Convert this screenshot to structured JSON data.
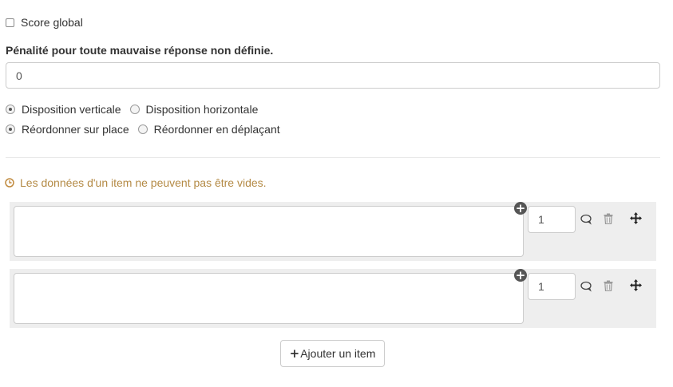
{
  "score_global": {
    "label": "Score global",
    "checked": false
  },
  "penalty": {
    "label": "Pénalité pour toute mauvaise réponse non définie.",
    "value": "0"
  },
  "layout_options": [
    {
      "label": "Disposition verticale",
      "selected": true
    },
    {
      "label": "Disposition horizontale",
      "selected": false
    }
  ],
  "reorder_options": [
    {
      "label": "Réordonner sur place",
      "selected": true
    },
    {
      "label": "Réordonner en déplaçant",
      "selected": false
    }
  ],
  "warning": {
    "text": "Les données d'un item ne peuvent pas être vides.",
    "icon": "clock-icon",
    "color": "#b48a45"
  },
  "items": [
    {
      "text": "",
      "score": "1"
    },
    {
      "text": "",
      "score": "1"
    }
  ],
  "add_button": {
    "plus": "+",
    "label": "Ajouter un item"
  }
}
